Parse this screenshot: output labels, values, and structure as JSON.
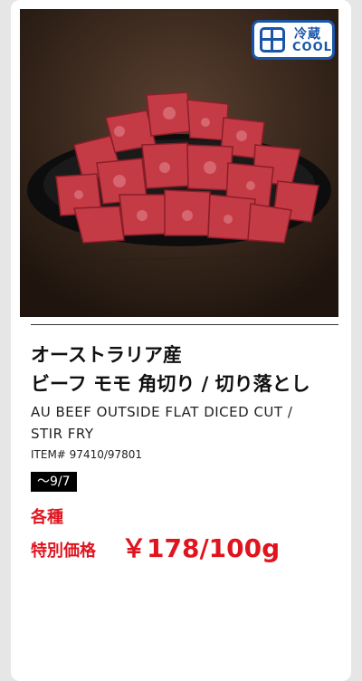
{
  "badge": {
    "jp": "冷蔵",
    "en": "COOL"
  },
  "product": {
    "title_line1": "オーストラリア産",
    "title_line2": "ビーフ モモ 角切り / 切り落とし",
    "english_line1": "AU BEEF OUTSIDE FLAT DICED CUT /",
    "english_line2": "STIR FRY",
    "item_number": "ITEM# 97410/97801",
    "date": "〜9/7",
    "variety": "各種",
    "special_label": "特別価格",
    "price": "￥178/100g"
  },
  "colors": {
    "accent_red": "#e0141e",
    "cool_blue": "#1a55a8"
  },
  "icons": {
    "cool": "refrigerator-icon",
    "photo": "beef-photo"
  }
}
